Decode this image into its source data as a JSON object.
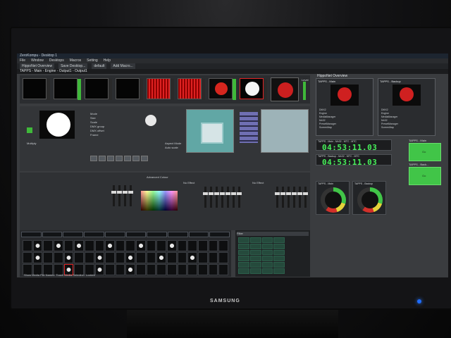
{
  "app": {
    "title": "ZeroKompu - Desktop 1",
    "menu": [
      "File",
      "Window",
      "Desktops",
      "Macros",
      "Setting",
      "Help"
    ],
    "toolbar": [
      "HippoNet Overview",
      "Save Desktop...",
      "default",
      "Add Macro..."
    ],
    "caption": "TAPPS - Main - Engine - Output1 - Output1"
  },
  "mid": {
    "props": [
      "Mode",
      "Size",
      "Scale",
      "DMX group",
      "DMX offset",
      "Frame"
    ],
    "blend_label": "Multiply",
    "aspect_label": "Aspect Mode",
    "aspect_value": "Auto scale"
  },
  "mixer": {
    "advanced_label": "Advanced Colour",
    "fx_label": "No Effect",
    "level_label": "Level"
  },
  "bank": {
    "status": [
      "Show Media File Names",
      "Touch Media Selection",
      "Locked"
    ]
  },
  "playlist": {
    "filter_label": "Filter"
  },
  "right": {
    "title": "HippoNet Overview",
    "nodes": [
      {
        "name": "TAPPS - Main",
        "items": [
          "DMX2",
          "Engine",
          "MediaManager",
          "Mx32",
          "PresetManager",
          "ScreenMap"
        ]
      },
      {
        "name": "TAPPS - Backup",
        "items": [
          "DMX2",
          "Engine",
          "MediaManager",
          "Mx32",
          "PresetManager",
          "ScreenMap"
        ]
      }
    ],
    "timecodes": [
      {
        "label": "TAPPS - Main - Mx32 - MTC - MTC",
        "time": "04:53:11.03"
      },
      {
        "label": "TAPPS - Backup - Mx32 - MTC - MTC",
        "time": "04:53:11.03"
      }
    ],
    "go_buttons": [
      {
        "caption": "TAPPS - Main",
        "label": "Go"
      },
      {
        "caption": "TAPPS - Back...",
        "label": "Go"
      }
    ],
    "gauges": [
      "TAPPS - Main",
      "TAPPS - Backup"
    ]
  },
  "monitor": {
    "brand": "SAMSUNG"
  },
  "colors": {
    "timecode": "#47f05a",
    "go_button": "#41c548",
    "accent_red": "#d6261e"
  }
}
